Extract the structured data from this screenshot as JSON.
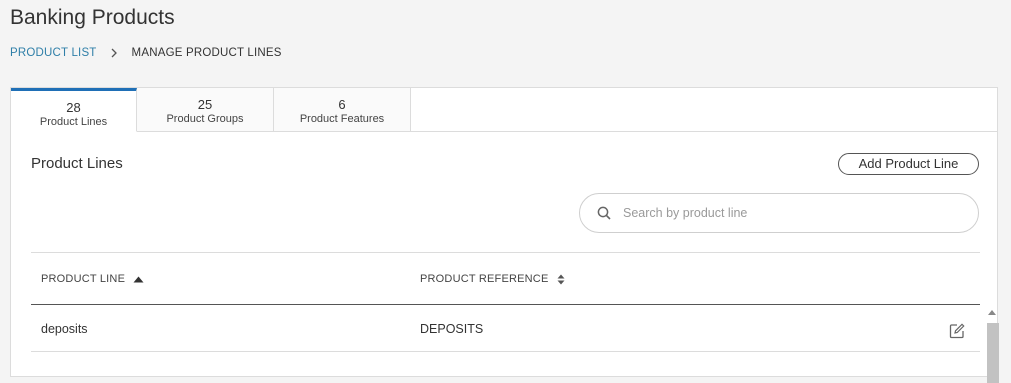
{
  "page": {
    "title": "Banking Products"
  },
  "breadcrumb": {
    "link": "PRODUCT LIST",
    "current": "MANAGE PRODUCT LINES"
  },
  "tabs": [
    {
      "count": "28",
      "label": "Product Lines",
      "active": true
    },
    {
      "count": "25",
      "label": "Product Groups",
      "active": false
    },
    {
      "count": "6",
      "label": "Product Features",
      "active": false
    }
  ],
  "section": {
    "title": "Product Lines",
    "add_label": "Add Product Line"
  },
  "search": {
    "placeholder": "Search by product line",
    "value": ""
  },
  "table": {
    "columns": [
      "PRODUCT LINE",
      "PRODUCT REFERENCE"
    ],
    "rows": [
      {
        "product_line": "deposits",
        "product_reference": "DEPOSITS"
      }
    ]
  },
  "colors": {
    "accent": "#1f6fb6",
    "link": "#2f7fa8"
  },
  "icons": {
    "breadcrumb_sep": "chevron-right-icon",
    "search": "search-icon",
    "sort_asc": "sort-asc-icon",
    "sort_both": "sort-icon",
    "edit": "edit-icon"
  }
}
